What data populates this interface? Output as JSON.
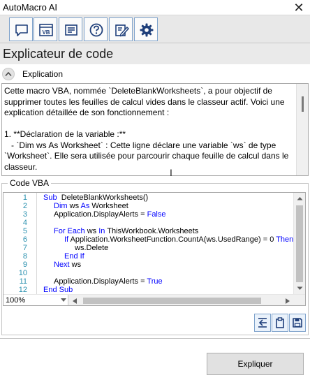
{
  "window": {
    "title": "AutoMacro AI",
    "close_glyph": "✕"
  },
  "toolbar": {
    "buttons": [
      {
        "icon": "chat-icon"
      },
      {
        "icon": "vba-module-icon",
        "badge": "VB"
      },
      {
        "icon": "form-list-icon"
      },
      {
        "icon": "help-icon"
      },
      {
        "icon": "edit-checklist-icon"
      },
      {
        "icon": "gear-icon"
      }
    ]
  },
  "header": {
    "title": "Explicateur de code"
  },
  "explanation": {
    "section_label": "Explication",
    "paragraphs": [
      "Cette macro VBA, nommée `DeleteBlankWorksheets`, a pour objectif de supprimer toutes les feuilles de calcul vides dans le classeur actif. Voici une explication détaillée de son fonctionnement :",
      "1. **Déclaration de la variable :**\n   - `Dim ws As Worksheet` : Cette ligne déclare une variable `ws` de type `Worksheet`. Elle sera utilisée pour parcourir chaque feuille de calcul dans le classeur."
    ]
  },
  "code_section": {
    "label": "Code VBA",
    "lines": [
      {
        "n": "1",
        "indent": 0,
        "parts": [
          [
            "kw",
            "Sub"
          ],
          [
            "",
            "  DeleteBlankWorksheets()"
          ]
        ]
      },
      {
        "n": "2",
        "indent": 1,
        "parts": [
          [
            "kw",
            "Dim"
          ],
          [
            "",
            " ws "
          ],
          [
            "kw",
            "As"
          ],
          [
            "",
            " Worksheet"
          ]
        ]
      },
      {
        "n": "3",
        "indent": 1,
        "parts": [
          [
            "",
            "Application.DisplayAlerts = "
          ],
          [
            "kw",
            "False"
          ]
        ]
      },
      {
        "n": "4",
        "indent": 0,
        "parts": []
      },
      {
        "n": "5",
        "indent": 1,
        "parts": [
          [
            "kw",
            "For Each"
          ],
          [
            "",
            " ws "
          ],
          [
            "kw",
            "In"
          ],
          [
            "",
            " ThisWorkbook.Worksheets"
          ]
        ]
      },
      {
        "n": "6",
        "indent": 2,
        "parts": [
          [
            "kw",
            "If"
          ],
          [
            "",
            " Application.WorksheetFunction.CountA(ws.UsedRange) = 0 "
          ],
          [
            "kw",
            "Then"
          ]
        ]
      },
      {
        "n": "7",
        "indent": 3,
        "parts": [
          [
            "",
            "ws.Delete"
          ]
        ]
      },
      {
        "n": "8",
        "indent": 2,
        "parts": [
          [
            "kw",
            "End If"
          ]
        ]
      },
      {
        "n": "9",
        "indent": 1,
        "parts": [
          [
            "kw",
            "Next"
          ],
          [
            "",
            " ws"
          ]
        ]
      },
      {
        "n": "10",
        "indent": 0,
        "parts": []
      },
      {
        "n": "11",
        "indent": 1,
        "parts": [
          [
            "",
            "Application.DisplayAlerts = "
          ],
          [
            "kw",
            "True"
          ]
        ]
      },
      {
        "n": "12",
        "indent": 0,
        "parts": [
          [
            "kw",
            "End Sub"
          ]
        ]
      }
    ],
    "zoom": "100%"
  },
  "code_actions": [
    {
      "icon": "insert-code-icon"
    },
    {
      "icon": "clipboard-icon"
    },
    {
      "icon": "save-icon"
    }
  ],
  "footer": {
    "explain_button_label": "Expliquer"
  },
  "colors": {
    "keyword": "#0000ff",
    "line_number": "#2b91af",
    "accent_border": "#7fa3cc"
  }
}
